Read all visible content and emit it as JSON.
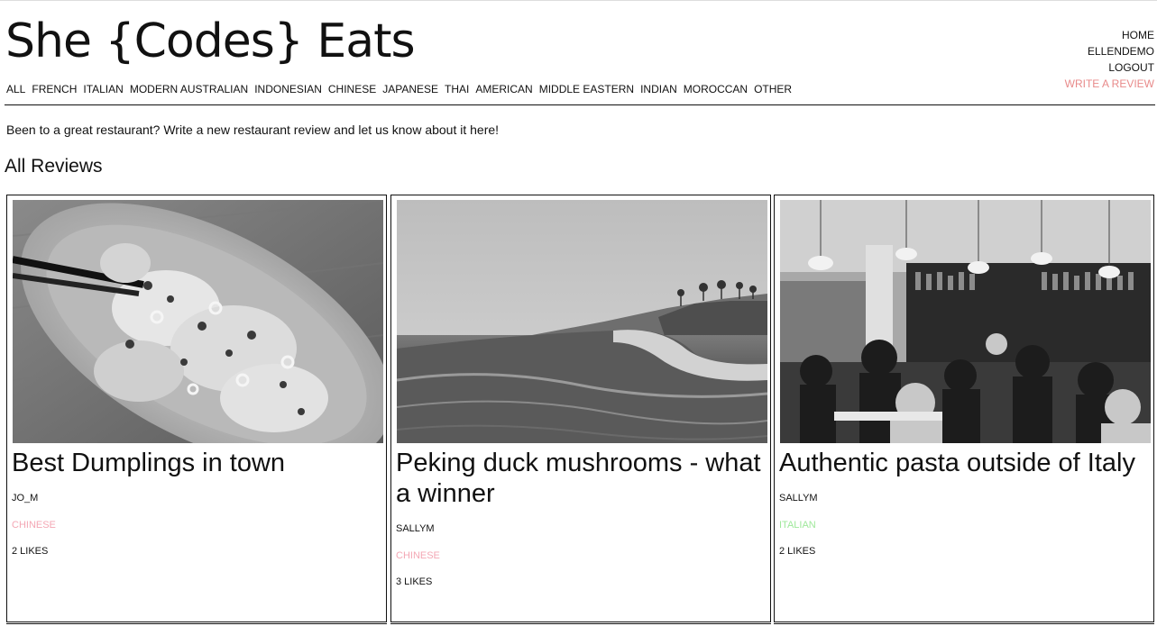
{
  "site": {
    "title": "She {Codes} Eats"
  },
  "nav": {
    "cuisines": [
      "ALL",
      "FRENCH",
      "ITALIAN",
      "MODERN AUSTRALIAN",
      "INDONESIAN",
      "CHINESE",
      "JAPANESE",
      "THAI",
      "AMERICAN",
      "MIDDLE EASTERN",
      "INDIAN",
      "MOROCCAN",
      "OTHER"
    ],
    "account": {
      "home": "HOME",
      "user": "ELLENDEMO",
      "logout": "LOGOUT",
      "write_review": "WRITE A REVIEW"
    }
  },
  "intro": "Been to a great restaurant? Write a new restaurant review and let us know about it here!",
  "section": {
    "title": "All Reviews"
  },
  "reviews": [
    {
      "title": "Best Dumplings in town",
      "author": "JO_M",
      "category": "CHINESE",
      "category_color": "#f4a7b4",
      "likes": "2 LIKES",
      "photo": "dumplings-photo"
    },
    {
      "title": "Peking duck mushrooms - what a winner",
      "author": "SALLYM",
      "category": "CHINESE",
      "category_color": "#f4a7b4",
      "likes": "3 LIKES",
      "photo": "ocean-wave-photo"
    },
    {
      "title": "Authentic pasta outside of Italy",
      "author": "SALLYM",
      "category": "ITALIAN",
      "category_color": "#9ee89a",
      "likes": "2 LIKES",
      "photo": "restaurant-interior-photo"
    }
  ]
}
